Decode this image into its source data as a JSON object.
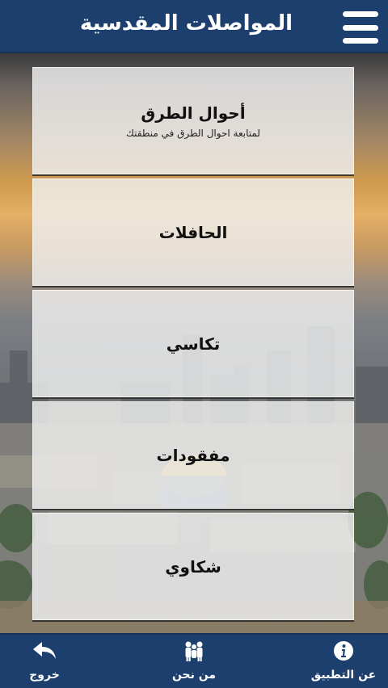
{
  "header": {
    "title": "المواصلات المقدسية",
    "menu_icon": "hamburger-menu-icon"
  },
  "menu": [
    {
      "title": "أحوال الطرق",
      "subtitle": "لمتابعة احوال الطرق في منطقتك"
    },
    {
      "title": "الحافلات"
    },
    {
      "title": "تكاسي"
    },
    {
      "title": "مفقودات"
    },
    {
      "title": "شكاوي"
    }
  ],
  "tabbar": {
    "about": {
      "label": "عن التطبيق",
      "icon": "info-icon"
    },
    "us": {
      "label": "من نحن",
      "icon": "people-icon"
    },
    "exit": {
      "label": "خروج",
      "icon": "reply-arrow-icon"
    }
  },
  "colors": {
    "bar": "#1c3f6e",
    "card": "#f0f0f0"
  }
}
